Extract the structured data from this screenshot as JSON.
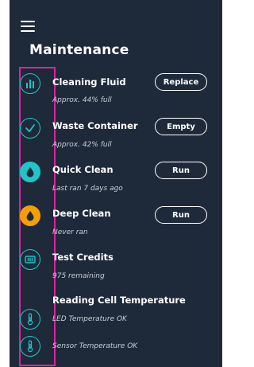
{
  "header": {
    "menu_icon": "hamburger-icon",
    "title": "Maintenance"
  },
  "rows": [
    {
      "icon": "bar-chart-icon",
      "title": "Cleaning Fluid",
      "subtitle": "Approx. 44% full",
      "fill_percent": 44,
      "button": "Replace"
    },
    {
      "icon": "check-icon",
      "title": "Waste Container",
      "subtitle": "Approx. 42% full",
      "fill_percent": 42,
      "button": "Empty"
    },
    {
      "icon": "droplet-icon",
      "title": "Quick Clean",
      "subtitle": "Last ran 7 days ago",
      "button": "Run"
    },
    {
      "icon": "droplet-icon",
      "title": "Deep Clean",
      "subtitle": "Never ran",
      "button": "Run"
    },
    {
      "icon": "credits-icon",
      "title": "Test Credits",
      "subtitle": "975 remaining"
    },
    {
      "icon": "thermometer-icon",
      "title": "Reading Cell Temperature",
      "subtitle": "LED Temperature OK"
    },
    {
      "icon": "thermometer-icon",
      "subtitle": "Sensor Temperature OK"
    }
  ],
  "colors": {
    "panel_bg": "#1e2a3a",
    "accent_teal": "#1fc5c8",
    "accent_orange": "#f5a000",
    "highlight_magenta": "#e020a0"
  }
}
